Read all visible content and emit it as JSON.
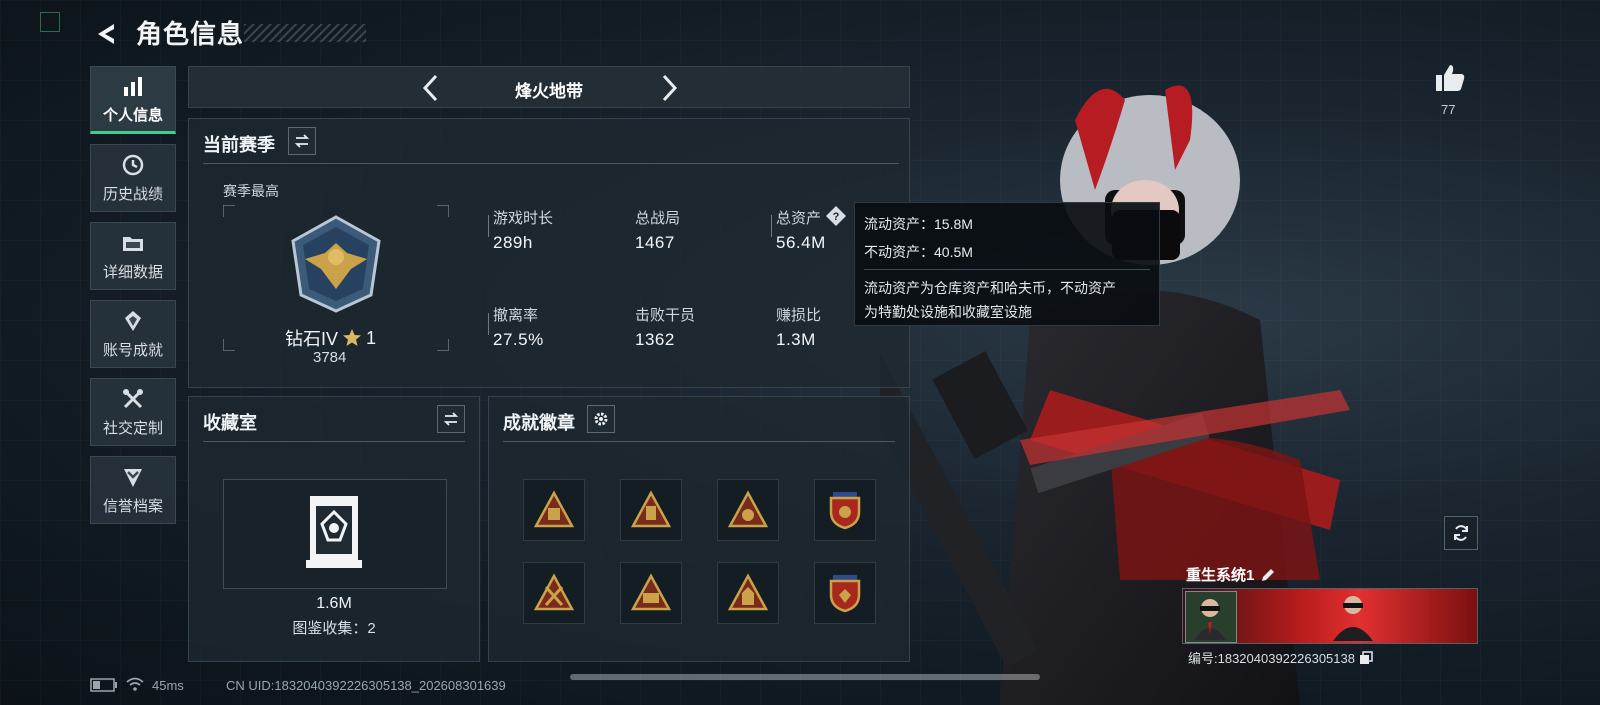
{
  "header": {
    "title": "角色信息"
  },
  "sidebar": {
    "items": [
      {
        "label": "个人信息",
        "icon": "bar-chart-icon",
        "active": true
      },
      {
        "label": "历史战绩",
        "icon": "history-clock-icon",
        "active": false
      },
      {
        "label": "详细数据",
        "icon": "folder-icon",
        "active": false
      },
      {
        "label": "账号成就",
        "icon": "achievement-icon",
        "active": false
      },
      {
        "label": "社交定制",
        "icon": "tools-icon",
        "active": false
      },
      {
        "label": "信誉档案",
        "icon": "shield-chevron-icon",
        "active": false
      }
    ]
  },
  "mode": {
    "name": "烽火地带"
  },
  "season": {
    "title": "当前赛季",
    "best_label": "赛季最高",
    "rank_name": "钻石IV",
    "rank_stars": "1",
    "rank_score": "3784",
    "stats": [
      {
        "label": "游戏时长",
        "value": "289h"
      },
      {
        "label": "总战局",
        "value": "1467"
      },
      {
        "label": "总资产",
        "value": "56.4M"
      },
      {
        "label": "撤离率",
        "value": "27.5%"
      },
      {
        "label": "击败干员",
        "value": "1362"
      },
      {
        "label": "赚损比",
        "value": "1.3M"
      }
    ]
  },
  "tooltip": {
    "liquid": "流动资产：15.8M",
    "fixed": "不动资产：40.5M",
    "desc_line1": "流动资产为仓库资产和哈夫币，不动资产",
    "desc_line2": "为特勤处设施和收藏室设施"
  },
  "collection": {
    "title": "收藏室",
    "value": "1.6M",
    "catalog": "图鉴收集：2"
  },
  "badges": {
    "title": "成就徽章"
  },
  "likes": {
    "count": "77"
  },
  "profile": {
    "name": "重生系统1",
    "id_text": "编号:1832040392226305138"
  },
  "status": {
    "ping": "45ms",
    "uid_text": "CN UID:1832040392226305138_202608301639"
  },
  "colors": {
    "accent": "#3ecf8e",
    "gold": "#c9a24a",
    "red": "#c8252a"
  }
}
